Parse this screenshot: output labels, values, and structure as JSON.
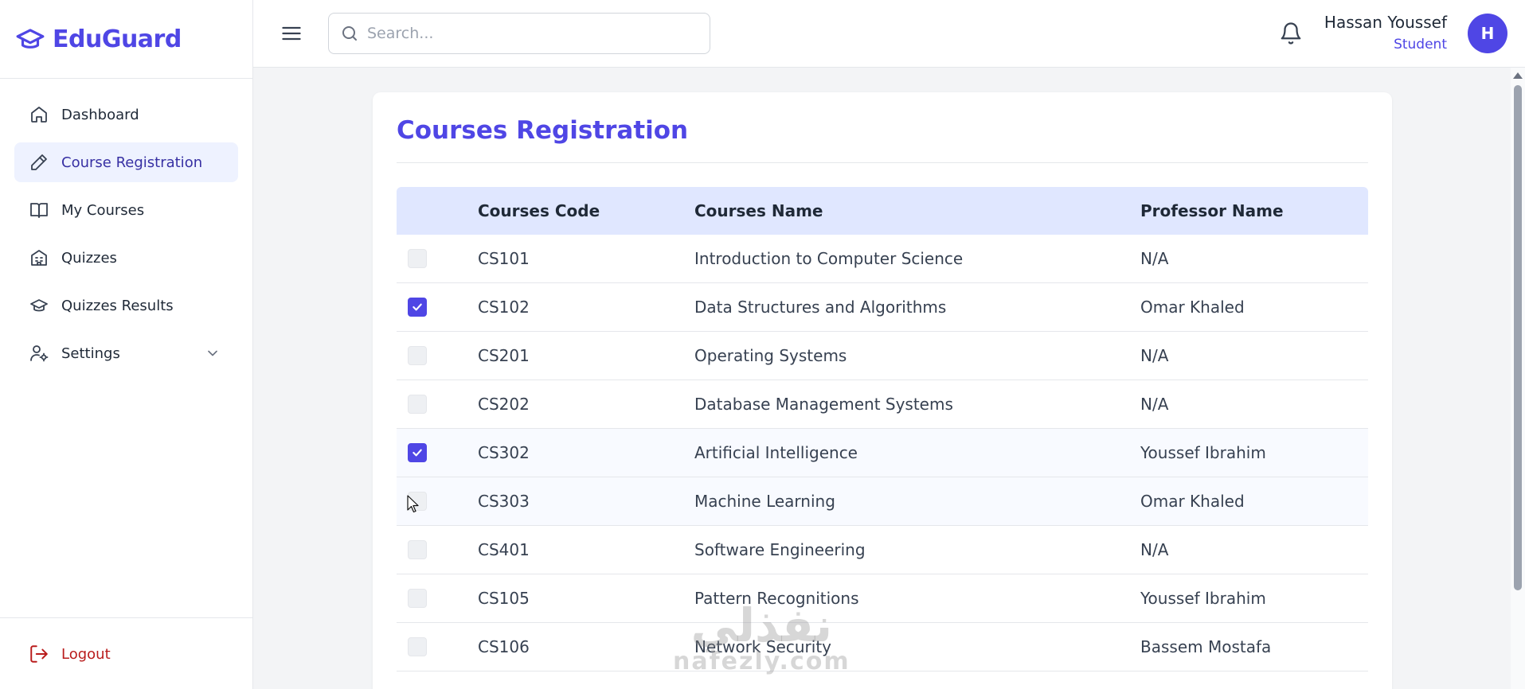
{
  "brand": {
    "name": "EduGuard",
    "icon": "graduation-cap-icon",
    "color": "#4f46e5"
  },
  "sidebar": {
    "items": [
      {
        "label": "Dashboard",
        "icon": "home-icon",
        "active": false
      },
      {
        "label": "Course Registration",
        "icon": "pencil-icon",
        "active": true
      },
      {
        "label": "My Courses",
        "icon": "book-open-icon",
        "active": false
      },
      {
        "label": "Quizzes",
        "icon": "building-icon",
        "active": false
      },
      {
        "label": "Quizzes Results",
        "icon": "graduation-cap-icon",
        "active": false
      },
      {
        "label": "Settings",
        "icon": "user-settings-icon",
        "active": false,
        "expandable": true
      }
    ],
    "logout_label": "Logout"
  },
  "header": {
    "search_placeholder": "Search...",
    "search_value": "",
    "user_name": "Hassan Youssef",
    "user_role": "Student",
    "avatar_initial": "H"
  },
  "page": {
    "title": "Courses Registration",
    "columns": [
      "Courses Code",
      "Courses Name",
      "Professor Name"
    ],
    "rows": [
      {
        "code": "CS101",
        "name": "Introduction to Computer Science",
        "professor": "N/A",
        "selected": false
      },
      {
        "code": "CS102",
        "name": "Data Structures and Algorithms",
        "professor": "Omar Khaled",
        "selected": true
      },
      {
        "code": "CS201",
        "name": "Operating Systems",
        "professor": "N/A",
        "selected": false
      },
      {
        "code": "CS202",
        "name": "Database Management Systems",
        "professor": "N/A",
        "selected": false
      },
      {
        "code": "CS302",
        "name": "Artificial Intelligence",
        "professor": "Youssef Ibrahim",
        "selected": true
      },
      {
        "code": "CS303",
        "name": "Machine Learning",
        "professor": "Omar Khaled",
        "selected": false
      },
      {
        "code": "CS401",
        "name": "Software Engineering",
        "professor": "N/A",
        "selected": false
      },
      {
        "code": "CS105",
        "name": "Pattern Recognitions",
        "professor": "Youssef Ibrahim",
        "selected": false
      },
      {
        "code": "CS106",
        "name": "Network Security",
        "professor": "Bassem Mostafa",
        "selected": false
      }
    ]
  },
  "watermark": {
    "arabic": "نفذلي",
    "latin": "nafezly.com"
  },
  "colors": {
    "accent": "#4f46e5",
    "active_bg": "#eef2ff",
    "table_header_bg": "#e0e7ff",
    "logout": "#b91c1c"
  }
}
